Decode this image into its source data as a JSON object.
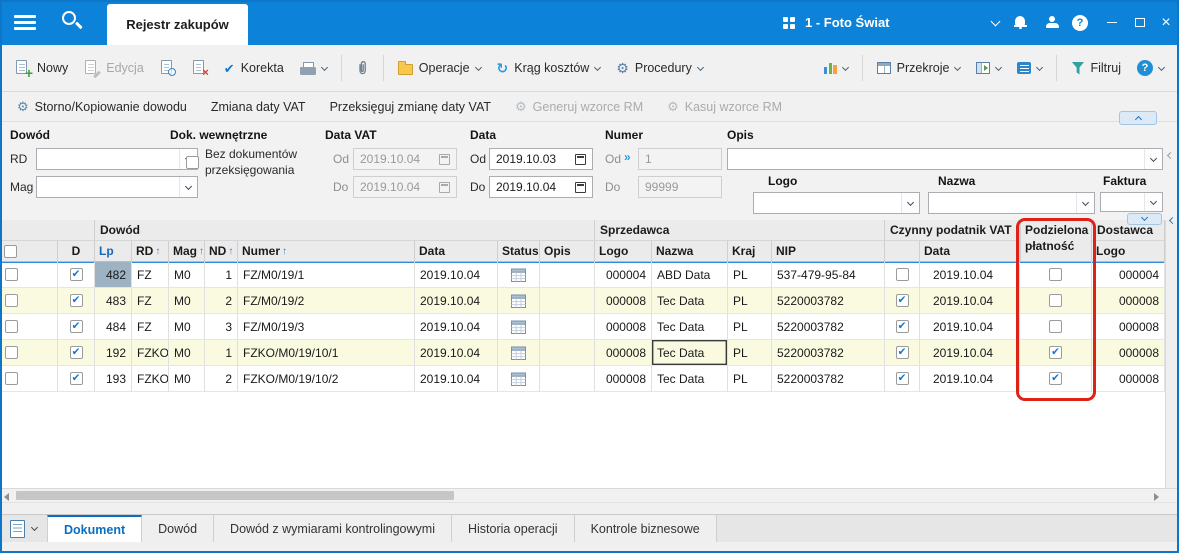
{
  "titlebar": {
    "tab": "Rejestr zakupów",
    "company": "1 - Foto Świat",
    "help_glyph": "?",
    "window_close": "×"
  },
  "toolbar_main": {
    "nowy": "Nowy",
    "edycja": "Edycja",
    "korekta": "Korekta",
    "operacje": "Operacje",
    "krag_kosztow": "Krąg kosztów",
    "procedury": "Procedury",
    "przekroje": "Przekroje",
    "filtruj": "Filtruj"
  },
  "toolbar_secondary": {
    "storno": "Storno/Kopiowanie dowodu",
    "zmiana_daty_vat": "Zmiana daty VAT",
    "przeksieguj": "Przeksięguj zmianę daty VAT",
    "generuj_wzorce": "Generuj wzorce RM",
    "kasuj_wzorce": "Kasuj wzorce RM"
  },
  "icons": {
    "plus": "+",
    "delete_x": "×",
    "check": "✔",
    "refresh": "↻",
    "gear": "⚙",
    "question": "?",
    "sort_asc": "↑",
    "gte": "»"
  },
  "filters": {
    "dowod": {
      "label": "Dowód",
      "rd_label": "RD",
      "rd_value": "",
      "mag_label": "Mag",
      "mag_value": ""
    },
    "dok_wewnetrzne": {
      "label": "Dok. wewnętrzne",
      "checkbox_label": "Bez dokumentów przeksięgowania",
      "checked": false
    },
    "data_vat": {
      "label": "Data VAT",
      "od_label": "Od",
      "od_value": "2019.10.04",
      "do_label": "Do",
      "do_value": "2019.10.04"
    },
    "data": {
      "label": "Data",
      "od_label": "Od",
      "od_value": "2019.10.03",
      "do_label": "Do",
      "do_value": "2019.10.04"
    },
    "numer": {
      "label": "Numer",
      "od_label": "Od",
      "od_value": "1",
      "do_label": "Do",
      "do_value": "99999"
    },
    "opis": {
      "label": "Opis",
      "value": ""
    },
    "logo": {
      "label": "Logo",
      "value": ""
    },
    "nazwa": {
      "label": "Nazwa",
      "value": ""
    },
    "faktura": {
      "label": "Faktura",
      "value": ""
    }
  },
  "grid": {
    "groups": {
      "dowod": "Dowód",
      "sprzedawca": "Sprzedawca",
      "czynny_podatnik": "Czynny podatnik VAT",
      "podzielona_platnosc": "Podzielona płatność",
      "dostawca": "Dostawca"
    },
    "columns": {
      "d": "D",
      "lp": "Lp",
      "rd": "RD",
      "mag": "Mag",
      "nd": "ND",
      "numer": "Numer",
      "data": "Data",
      "status": "Status",
      "opis": "Opis",
      "logo": "Logo",
      "nazwa": "Nazwa",
      "kraj": "Kraj",
      "nip": "NIP",
      "czynny_data": "Data",
      "dostawca_logo": "Logo"
    },
    "rows": [
      {
        "selected": true,
        "d": true,
        "lp": "482",
        "rd": "FZ",
        "mag": "M0",
        "nd": "1",
        "numer": "FZ/M0/19/1",
        "data": "2019.10.04",
        "opis": "",
        "sprzedawca_logo": "000004",
        "nazwa": "ABD Data",
        "kraj": "PL",
        "nip": "537-479-95-84",
        "czynny_podatnik": false,
        "czynny_data": "2019.10.04",
        "podzielona_platnosc": false,
        "dostawca_logo": "000004"
      },
      {
        "selected": false,
        "d": true,
        "lp": "483",
        "rd": "FZ",
        "mag": "M0",
        "nd": "2",
        "numer": "FZ/M0/19/2",
        "data": "2019.10.04",
        "opis": "",
        "sprzedawca_logo": "000008",
        "nazwa": "Tec Data",
        "kraj": "PL",
        "nip": "5220003782",
        "czynny_podatnik": true,
        "czynny_data": "2019.10.04",
        "podzielona_platnosc": false,
        "dostawca_logo": "000008"
      },
      {
        "selected": false,
        "d": true,
        "lp": "484",
        "rd": "FZ",
        "mag": "M0",
        "nd": "3",
        "numer": "FZ/M0/19/3",
        "data": "2019.10.04",
        "opis": "",
        "sprzedawca_logo": "000008",
        "nazwa": "Tec Data",
        "kraj": "PL",
        "nip": "5220003782",
        "czynny_podatnik": true,
        "czynny_data": "2019.10.04",
        "podzielona_platnosc": false,
        "dostawca_logo": "000008"
      },
      {
        "selected": false,
        "d": true,
        "lp": "192",
        "rd": "FZKO",
        "mag": "M0",
        "nd": "1",
        "numer": "FZKO/M0/19/10/1",
        "data": "2019.10.04",
        "opis": "",
        "sprzedawca_logo": "000008",
        "nazwa": "Tec Data",
        "kraj": "PL",
        "nip": "5220003782",
        "czynny_podatnik": true,
        "czynny_data": "2019.10.04",
        "podzielona_platnosc": true,
        "dostawca_logo": "000008",
        "focused_cell": "nazwa"
      },
      {
        "selected": false,
        "d": true,
        "lp": "193",
        "rd": "FZKO",
        "mag": "M0",
        "nd": "2",
        "numer": "FZKO/M0/19/10/2",
        "data": "2019.10.04",
        "opis": "",
        "sprzedawca_logo": "000008",
        "nazwa": "Tec Data",
        "kraj": "PL",
        "nip": "5220003782",
        "czynny_podatnik": true,
        "czynny_data": "2019.10.04",
        "podzielona_platnosc": true,
        "dostawca_logo": "000008"
      }
    ]
  },
  "bottom_tabs": {
    "items": [
      {
        "label": "Dokument",
        "active": true
      },
      {
        "label": "Dowód",
        "active": false
      },
      {
        "label": "Dowód z wymiarami kontrolingowymi",
        "active": false
      },
      {
        "label": "Historia operacji",
        "active": false
      },
      {
        "label": "Kontrole biznesowe",
        "active": false
      }
    ]
  },
  "colors": {
    "titlebar_blue": "#0d82d9",
    "accent_blue": "#1279cf",
    "active_tab_blue": "#0a6fc2",
    "annotation_red": "#df2218",
    "row_alt": "#fafae1",
    "selected_cell_bg": "#9db3c4"
  }
}
